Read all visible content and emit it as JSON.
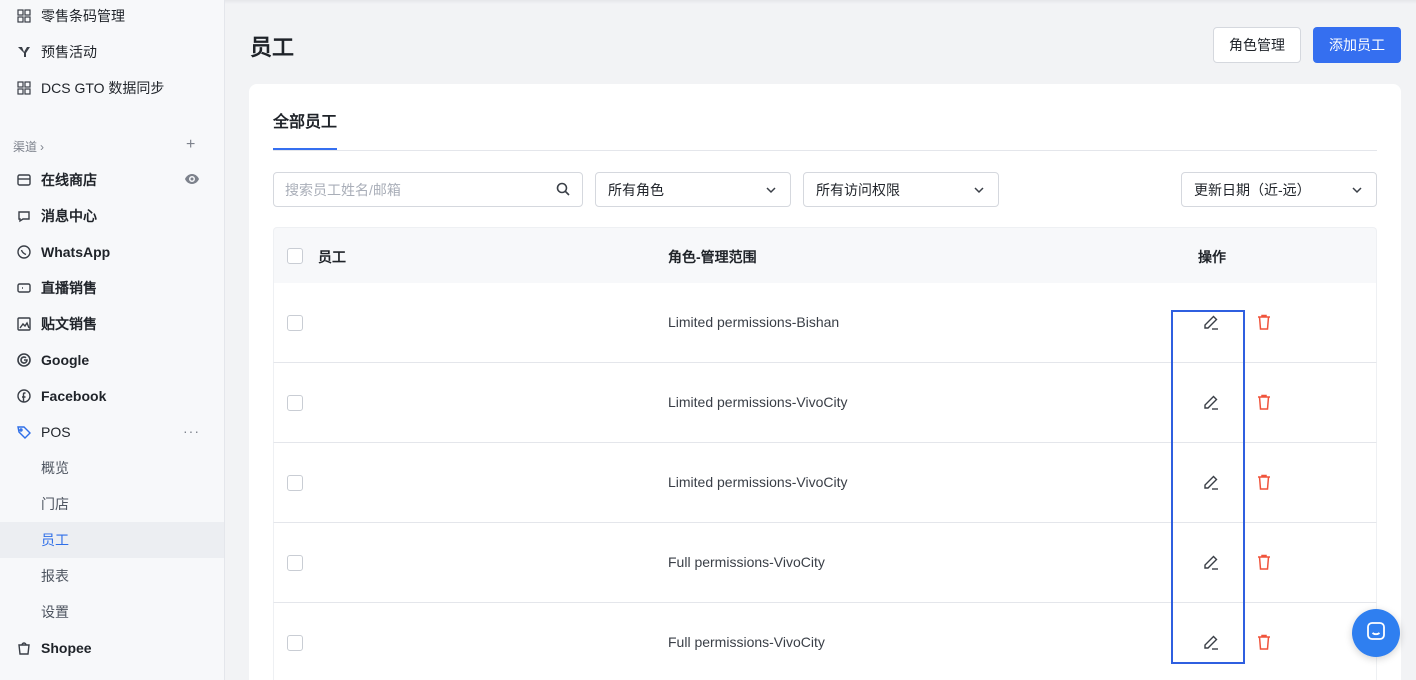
{
  "sidebar": {
    "items_top": [
      {
        "label": "零售条码管理",
        "icon": "grid-icon"
      },
      {
        "label": "预售活动",
        "icon": "presale-icon"
      },
      {
        "label": "DCS GTO 数据同步",
        "icon": "grid-icon"
      }
    ],
    "group_label": "渠道",
    "channels": [
      {
        "label": "在线商店",
        "icon": "store-icon"
      },
      {
        "label": "消息中心",
        "icon": "message-icon"
      },
      {
        "label": "WhatsApp",
        "icon": "whatsapp-icon"
      },
      {
        "label": "直播销售",
        "icon": "live-icon"
      },
      {
        "label": "贴文销售",
        "icon": "post-icon"
      },
      {
        "label": "Google",
        "icon": "google-icon"
      },
      {
        "label": "Facebook",
        "icon": "facebook-icon"
      },
      {
        "label": "POS",
        "icon": "pos-tag-icon"
      }
    ],
    "pos_sub": [
      {
        "label": "概览"
      },
      {
        "label": "门店"
      },
      {
        "label": "员工",
        "active": true
      },
      {
        "label": "报表"
      },
      {
        "label": "设置"
      }
    ],
    "bottom": {
      "label": "Shopee",
      "icon": "shopee-icon"
    }
  },
  "header": {
    "title": "员工",
    "role_button": "角色管理",
    "add_button": "添加员工"
  },
  "tabs": [
    {
      "label": "全部员工",
      "active": true
    }
  ],
  "filters": {
    "search_placeholder": "搜索员工姓名/邮箱",
    "role": "所有角色",
    "access": "所有访问权限",
    "sort": "更新日期（近-远）"
  },
  "table": {
    "columns": {
      "employee": "员工",
      "role_scope": "角色-管理范围",
      "actions": "操作"
    },
    "rows": [
      {
        "name": "",
        "role": "Limited permissions-Bishan"
      },
      {
        "name": "",
        "role": "Limited permissions-VivoCity"
      },
      {
        "name": "",
        "role": "Limited permissions-VivoCity"
      },
      {
        "name": "",
        "role": "Full permissions-VivoCity"
      },
      {
        "name": "",
        "role": "Full permissions-VivoCity"
      }
    ]
  },
  "colors": {
    "primary": "#356ff0",
    "danger": "#f0543c",
    "highlight": "#2f5fe0"
  }
}
